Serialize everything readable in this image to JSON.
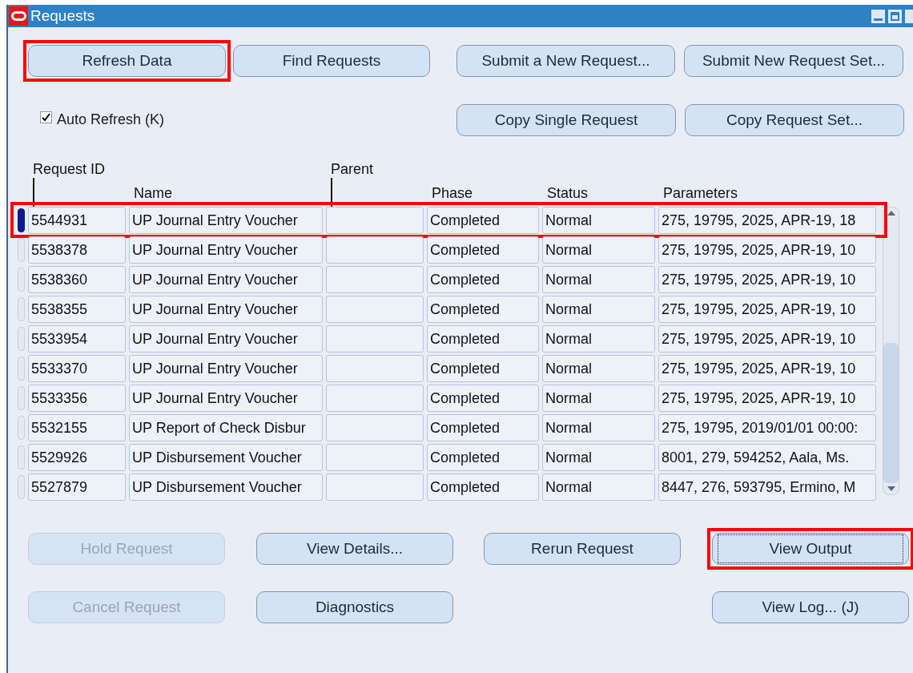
{
  "window": {
    "title": "Requests"
  },
  "top_buttons": [
    {
      "label": "Refresh Data",
      "highlighted": true
    },
    {
      "label": "Find Requests",
      "highlighted": false
    },
    {
      "label": "Submit a New Request...",
      "highlighted": false
    },
    {
      "label": "Submit New Request Set...",
      "highlighted": false
    }
  ],
  "auto_refresh": {
    "label": "Auto Refresh (K)",
    "checked": true
  },
  "copy_buttons": [
    {
      "label": "Copy Single Request"
    },
    {
      "label": "Copy Request Set..."
    }
  ],
  "table": {
    "columns": [
      {
        "label": "Request ID",
        "kind": "upper"
      },
      {
        "label": "Name",
        "kind": "lower"
      },
      {
        "label": "Parent",
        "kind": "upper"
      },
      {
        "label": "Phase",
        "kind": "lower"
      },
      {
        "label": "Status",
        "kind": "lower"
      },
      {
        "label": "Parameters",
        "kind": "lower"
      }
    ],
    "rows": [
      {
        "id": "5544931",
        "name": "UP Journal Entry Voucher",
        "phase": "Completed",
        "status": "Normal",
        "parameters": "275, 19795, 2025, APR-19, 18",
        "selected": true,
        "highlighted": true
      },
      {
        "id": "5538378",
        "name": "UP Journal Entry Voucher",
        "phase": "Completed",
        "status": "Normal",
        "parameters": "275, 19795, 2025, APR-19, 10",
        "selected": false,
        "highlighted": false
      },
      {
        "id": "5538360",
        "name": "UP Journal Entry Voucher",
        "phase": "Completed",
        "status": "Normal",
        "parameters": "275, 19795, 2025, APR-19, 10",
        "selected": false,
        "highlighted": false
      },
      {
        "id": "5538355",
        "name": "UP Journal Entry Voucher",
        "phase": "Completed",
        "status": "Normal",
        "parameters": "275, 19795, 2025, APR-19, 10",
        "selected": false,
        "highlighted": false
      },
      {
        "id": "5533954",
        "name": "UP Journal Entry Voucher",
        "phase": "Completed",
        "status": "Normal",
        "parameters": "275, 19795, 2025, APR-19, 10",
        "selected": false,
        "highlighted": false
      },
      {
        "id": "5533370",
        "name": "UP Journal Entry Voucher",
        "phase": "Completed",
        "status": "Normal",
        "parameters": "275, 19795, 2025, APR-19, 10",
        "selected": false,
        "highlighted": false
      },
      {
        "id": "5533356",
        "name": "UP Journal Entry Voucher",
        "phase": "Completed",
        "status": "Normal",
        "parameters": "275, 19795, 2025, APR-19, 10",
        "selected": false,
        "highlighted": false
      },
      {
        "id": "5532155",
        "name": "UP Report of Check Disbur",
        "phase": "Completed",
        "status": "Normal",
        "parameters": "275, 19795, 2019/01/01 00:00:",
        "selected": false,
        "highlighted": false
      },
      {
        "id": "5529926",
        "name": "UP Disbursement Voucher",
        "phase": "Completed",
        "status": "Normal",
        "parameters": "8001, 279, 594252, Aala, Ms.",
        "selected": false,
        "highlighted": false
      },
      {
        "id": "5527879",
        "name": "UP Disbursement Voucher",
        "phase": "Completed",
        "status": "Normal",
        "parameters": "8447, 276, 593795, Ermino, M",
        "selected": false,
        "highlighted": false
      }
    ]
  },
  "bottom_buttons": [
    [
      {
        "label": "Hold Request",
        "disabled": true,
        "highlighted": false,
        "focused": false
      },
      {
        "label": "View Details...",
        "disabled": false,
        "highlighted": false,
        "focused": false
      },
      {
        "label": "Rerun Request",
        "disabled": false,
        "highlighted": false,
        "focused": false
      },
      {
        "label": "View Output",
        "disabled": false,
        "highlighted": true,
        "focused": true
      }
    ],
    [
      {
        "label": "Cancel Request",
        "disabled": true,
        "highlighted": false,
        "focused": false
      },
      {
        "label": "Diagnostics",
        "disabled": false,
        "highlighted": false,
        "focused": false
      },
      {
        "label": "View Log... (J)",
        "disabled": false,
        "highlighted": false,
        "focused": false
      }
    ]
  ]
}
